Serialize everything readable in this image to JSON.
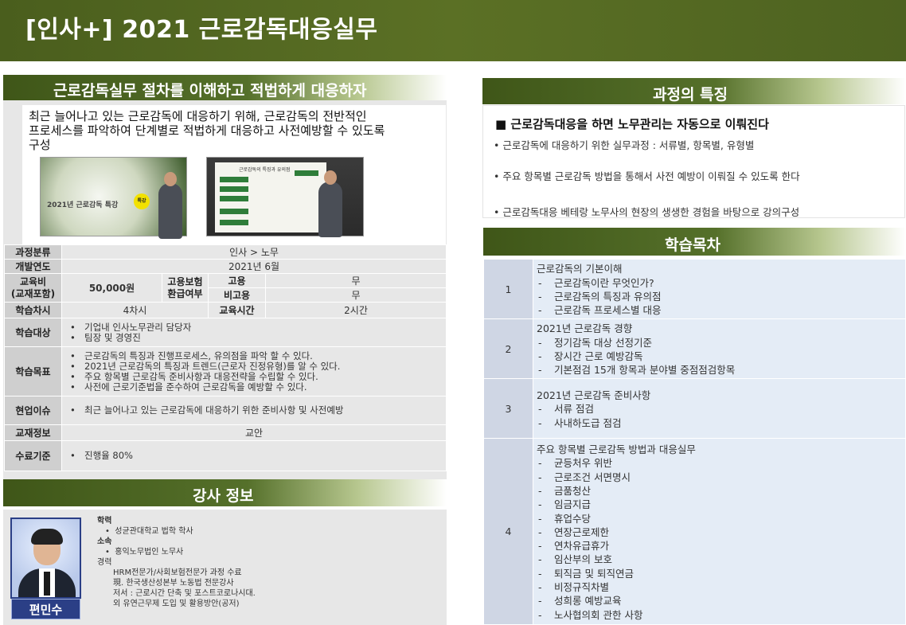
{
  "header": {
    "title": "[인사+] 2021 근로감독대응실무"
  },
  "left": {
    "section_title": "근로감독실무 절차를 이해하고 적법하게 대응하자",
    "intro_lines": [
      "최근 늘어나고 있는 근로감독에 대응하기 위해, 근로감독의 전반적인",
      "프로세스를 파악하여 단계별로 적법하게 대응하고 사전예방할 수 있도록",
      "구성"
    ],
    "thumb1_title": "2021년 근로감독 특강",
    "thumb1_badge": "특강",
    "thumb2_caption": "근로감독의 특징과 유의점"
  },
  "info": {
    "category_label": "과정분류",
    "category_value": "인사 > 노무",
    "year_label": "개발연도",
    "year_value": "2021년 6월",
    "fee_label": "교육비\n(교재포함)",
    "fee_value": "50,000원",
    "refund_label": "고용보험\n환급여부",
    "emp_label": "고용",
    "emp_value": "무",
    "nonemp_label": "비고용",
    "nonemp_value": "무",
    "sessions_label": "학습차시",
    "sessions_value": "4차시",
    "time_label": "교육시간",
    "time_value": "2시간",
    "target_label": "학습대상",
    "target_items": [
      "기업내 인사노무관리 담당자",
      "팀장 및 경영진"
    ],
    "goal_label": "학습목표",
    "goal_items": [
      "근로감독의 특징과 진행프로세스, 유의점을 파악 할 수 있다.",
      "2021년 근로감독의 특징과 트렌드(근로자 진정유형)를 알 수 있다.",
      "주요 항목별 근로감독 준비사항과 대응전략을 수립할 수 있다.",
      "사전에 근로기준법을 준수하여 근로감독을 예방할 수 있다."
    ],
    "issue_label": "현업이슈",
    "issue_items": [
      "최근 늘어나고 있는 근로감독에 대응하기 위한 준비사항 및 사전예방"
    ],
    "material_label": "교재정보",
    "material_value": "교안",
    "complete_label": "수료기준",
    "complete_items": [
      "진행율 80%"
    ]
  },
  "instructor": {
    "section_title": "강사 정보",
    "name": "편민수",
    "edu_label": "학력",
    "edu_value": "성균관대학교 법학 학사",
    "org_label": "소속",
    "org_value": "홍익노무법인 노무사",
    "career_label": "경력",
    "career_items": [
      "HRM전문가/사회보험전문가 과정 수료",
      "現. 한국생산성본부 노동법 전문강사",
      "저서 : 근로시간 단축 및 포스트코로나시대.",
      "외 유연근무제 도입 및 활용방안(공저)"
    ]
  },
  "features": {
    "section_title": "과정의 특징",
    "headline": "■ 근로감독대응을 하면 노무관리는 자동으로 이뤄진다",
    "items": [
      "•  근로감독에 대응하기 위한 실무과정 : 서류별, 항목별, 유형별",
      "•  주요 항목별 근로감독 방법을 통해서 사전 예방이 이뤄질 수 있도록 한다",
      "•  근로감독대응 베테랑 노무사의 현장의 생생한 경험을 바탕으로 강의구성"
    ]
  },
  "toc": {
    "section_title": "학습목차",
    "chapters": [
      {
        "num": "1",
        "title": "근로감독의 기본이해",
        "items": [
          "근로감독이란 무엇인가?",
          "근로감독의 특징과 유의점",
          "근로감독 프로세스별 대응"
        ]
      },
      {
        "num": "2",
        "title": "2021년 근로감독 경향",
        "items": [
          "정기감독 대상 선정기준",
          "장시간 근로 예방감독",
          "기본점검 15개 항목과 분야별 중점점검항목"
        ]
      },
      {
        "num": "3",
        "title": "2021년 근로감독 준비사항",
        "items": [
          "서류 점검",
          "사내하도급 점검"
        ]
      },
      {
        "num": "4",
        "title": "주요 항목별 근로감독 방법과 대응실무",
        "items": [
          "균등처우 위반",
          "근로조건 서면명시",
          "금품청산",
          "임금지급",
          "휴업수당",
          "연장근로제한",
          "연차유급휴가",
          "임산부의 보호",
          "퇴직금 및 퇴직연금",
          "비정규직차별",
          "성희롱 예방교육",
          "노사협의회 관한 사항"
        ]
      }
    ]
  }
}
